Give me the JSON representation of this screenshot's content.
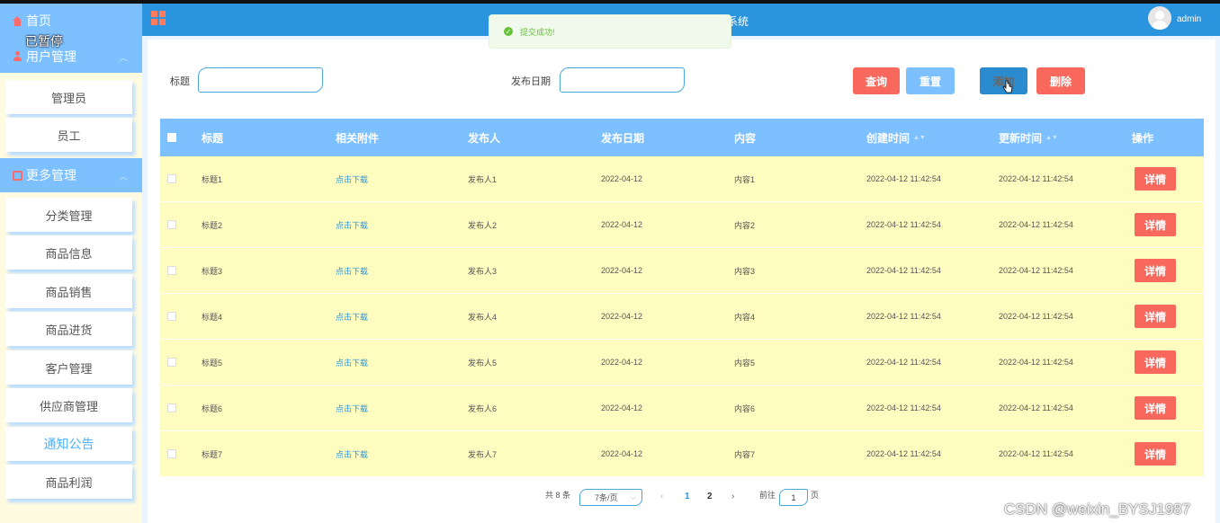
{
  "sidebar": {
    "home_label": "首页",
    "paused_label": "已暂停",
    "group_user": "用户管理",
    "group_more": "更多管理",
    "user_items": [
      "管理员",
      "员工"
    ],
    "more_items": [
      "分类管理",
      "商品信息",
      "商品销售",
      "商品进货",
      "客户管理",
      "供应商管理",
      "通知公告",
      "商品利润"
    ],
    "active_item": "通知公告"
  },
  "topbar": {
    "system_title": "系统",
    "username": "admin"
  },
  "toast": {
    "message": "提交成功!"
  },
  "search": {
    "title_label": "标题",
    "date_label": "发布日期",
    "query_button": "查询",
    "reset_button": "重置",
    "add_button": "添加",
    "delete_button": "删除"
  },
  "table": {
    "headers": [
      "标题",
      "相关附件",
      "发布人",
      "发布日期",
      "内容",
      "创建时间",
      "更新时间",
      "操作"
    ],
    "rows": [
      {
        "title": "标题1",
        "attachment": "点击下载",
        "publisher": "发布人1",
        "publish_date": "2022-04-12",
        "content": "内容1",
        "created": "2022-04-12 11:42:54",
        "updated": "2022-04-12 11:42:54",
        "action": "详情"
      },
      {
        "title": "标题2",
        "attachment": "点击下载",
        "publisher": "发布人2",
        "publish_date": "2022-04-12",
        "content": "内容2",
        "created": "2022-04-12 11:42:54",
        "updated": "2022-04-12 11:42:54",
        "action": "详情"
      },
      {
        "title": "标题3",
        "attachment": "点击下载",
        "publisher": "发布人3",
        "publish_date": "2022-04-12",
        "content": "内容3",
        "created": "2022-04-12 11:42:54",
        "updated": "2022-04-12 11:42:54",
        "action": "详情"
      },
      {
        "title": "标题4",
        "attachment": "点击下载",
        "publisher": "发布人4",
        "publish_date": "2022-04-12",
        "content": "内容4",
        "created": "2022-04-12 11:42:54",
        "updated": "2022-04-12 11:42:54",
        "action": "详情"
      },
      {
        "title": "标题5",
        "attachment": "点击下载",
        "publisher": "发布人5",
        "publish_date": "2022-04-12",
        "content": "内容5",
        "created": "2022-04-12 11:42:54",
        "updated": "2022-04-12 11:42:54",
        "action": "详情"
      },
      {
        "title": "标题6",
        "attachment": "点击下载",
        "publisher": "发布人6",
        "publish_date": "2022-04-12",
        "content": "内容6",
        "created": "2022-04-12 11:42:54",
        "updated": "2022-04-12 11:42:54",
        "action": "详情"
      },
      {
        "title": "标题7",
        "attachment": "点击下载",
        "publisher": "发布人7",
        "publish_date": "2022-04-12",
        "content": "内容7",
        "created": "2022-04-12 11:42:54",
        "updated": "2022-04-12 11:42:54",
        "action": "详情"
      }
    ]
  },
  "pagination": {
    "total": "共 8 条",
    "page_size": "7条/页",
    "pages": [
      "1",
      "2"
    ],
    "current_page": "1",
    "goto_label": "前往",
    "goto_value": "1",
    "page_suffix": "页",
    "prev": "‹",
    "next": "›"
  },
  "watermark": "CSDN @weixin_BYSJ1987",
  "colors": {
    "topbar": "#2a95de",
    "sidebar_header": "#7cc0ff",
    "row_bg": "#fffcc0",
    "danger": "#f9685c",
    "success": "#67c23a"
  }
}
